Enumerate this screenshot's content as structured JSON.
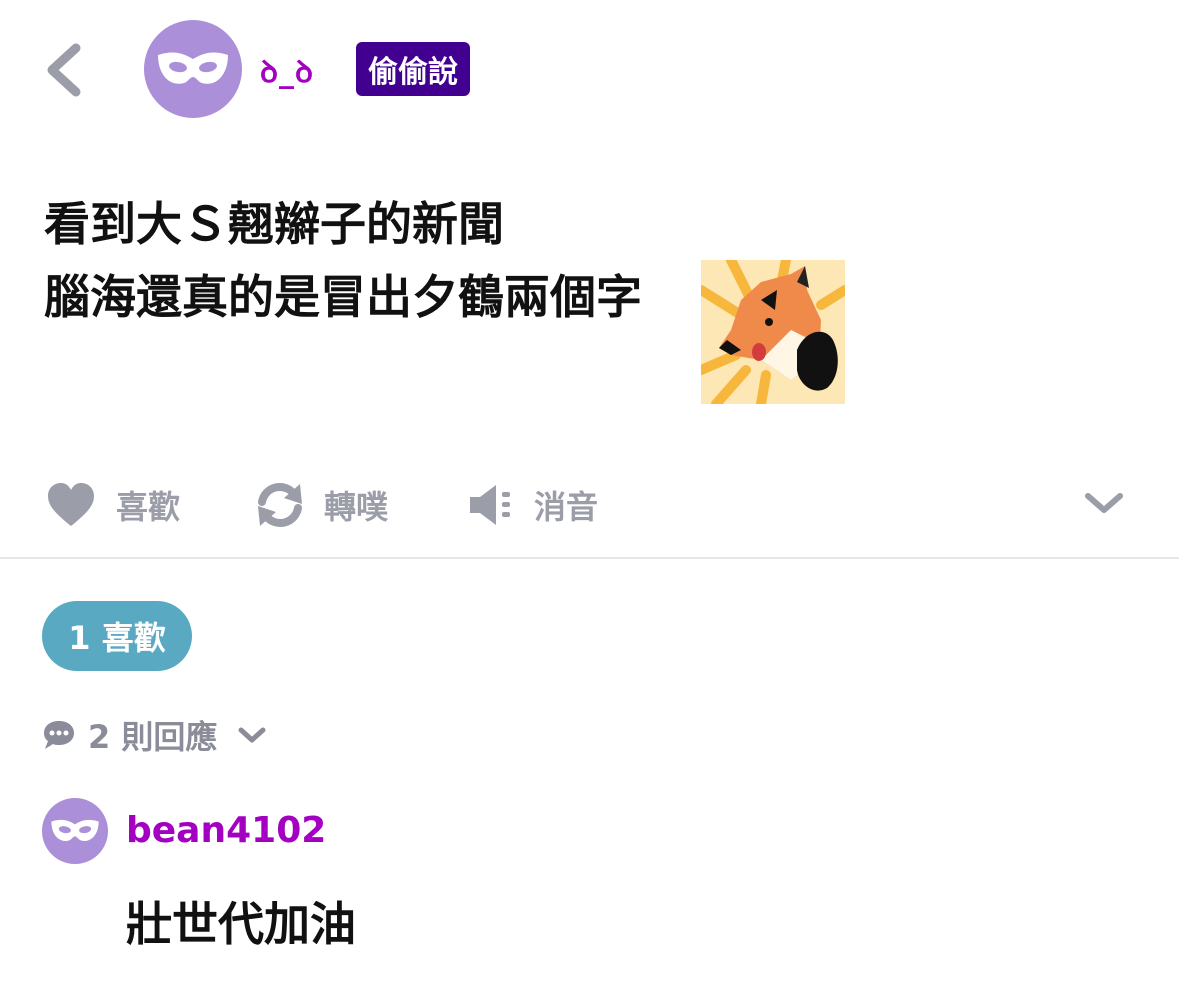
{
  "post": {
    "author": "ꝺ_ꝺ",
    "tag": "偷偷說",
    "lines": [
      "看到大Ｓ翹辮子的新聞",
      "腦海還真的是冒出夕鶴兩個字"
    ],
    "sticker_icon": "fox-sticker"
  },
  "actions": {
    "like": "喜歡",
    "replurk": "轉噗",
    "mute": "消音"
  },
  "likes_pill": "1 喜歡",
  "replies_toggle": "2 則回應",
  "comment": {
    "user": "bean4102",
    "text": "壯世代加油"
  },
  "colors": {
    "author": "#a400c2",
    "tag_bg": "#420090",
    "pill_bg": "#5aa9c3",
    "avatar_bg": "#ab8fd9"
  }
}
